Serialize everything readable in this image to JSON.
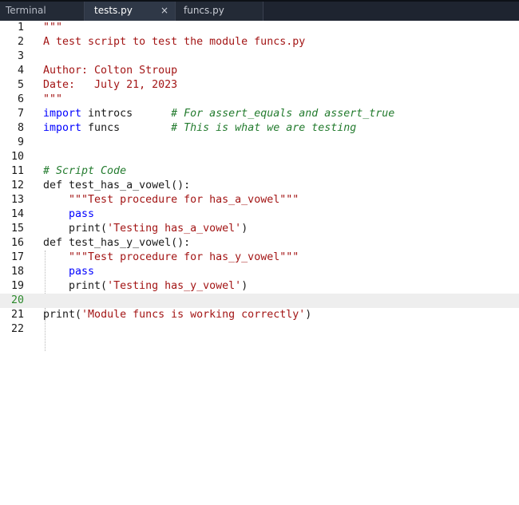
{
  "tabs": [
    {
      "label": "Terminal"
    },
    {
      "label": "tests.py",
      "close": "×"
    },
    {
      "label": "funcs.py"
    }
  ],
  "lines": [
    {
      "n": "1",
      "parts": [
        {
          "t": "\"\"\"",
          "c": "str"
        }
      ]
    },
    {
      "n": "2",
      "parts": [
        {
          "t": "A test script to test the module funcs.py",
          "c": "str"
        }
      ]
    },
    {
      "n": "3",
      "parts": []
    },
    {
      "n": "4",
      "parts": [
        {
          "t": "Author: Colton Stroup",
          "c": "str"
        }
      ]
    },
    {
      "n": "5",
      "parts": [
        {
          "t": "Date:   July 21, 2023",
          "c": "str"
        }
      ]
    },
    {
      "n": "6",
      "parts": [
        {
          "t": "\"\"\"",
          "c": "str"
        }
      ]
    },
    {
      "n": "7",
      "parts": [
        {
          "t": "import",
          "c": "kw"
        },
        {
          "t": " introcs      ",
          "c": "plain"
        },
        {
          "t": "# For assert_equals and assert_true",
          "c": "cmt"
        }
      ]
    },
    {
      "n": "8",
      "parts": [
        {
          "t": "import",
          "c": "kw"
        },
        {
          "t": " funcs        ",
          "c": "plain"
        },
        {
          "t": "# This is what we are testing",
          "c": "cmt"
        }
      ]
    },
    {
      "n": "9",
      "parts": []
    },
    {
      "n": "10",
      "parts": []
    },
    {
      "n": "11",
      "parts": [
        {
          "t": "# Script Code",
          "c": "cmt"
        }
      ]
    },
    {
      "n": "12",
      "parts": [
        {
          "t": "def test_has_a_vowel():",
          "c": "plain"
        }
      ]
    },
    {
      "n": "13",
      "parts": [
        {
          "t": "    ",
          "c": "plain"
        },
        {
          "t": "\"\"\"Test procedure for has_a_vowel\"\"\"",
          "c": "str"
        }
      ]
    },
    {
      "n": "14",
      "parts": [
        {
          "t": "    ",
          "c": "plain"
        },
        {
          "t": "pass",
          "c": "kw"
        }
      ]
    },
    {
      "n": "15",
      "parts": [
        {
          "t": "    print(",
          "c": "plain"
        },
        {
          "t": "'Testing has_a_vowel'",
          "c": "str"
        },
        {
          "t": ")",
          "c": "plain"
        }
      ]
    },
    {
      "n": "16",
      "parts": [
        {
          "t": "def test_has_y_vowel():",
          "c": "plain"
        }
      ]
    },
    {
      "n": "17",
      "parts": [
        {
          "t": "    ",
          "c": "plain"
        },
        {
          "t": "\"\"\"Test procedure for has_y_vowel\"\"\"",
          "c": "str"
        }
      ]
    },
    {
      "n": "18",
      "parts": [
        {
          "t": "    ",
          "c": "plain"
        },
        {
          "t": "pass",
          "c": "kw"
        }
      ]
    },
    {
      "n": "19",
      "parts": [
        {
          "t": "    print(",
          "c": "plain"
        },
        {
          "t": "'Testing has_y_vowel'",
          "c": "str"
        },
        {
          "t": ")",
          "c": "plain"
        }
      ]
    },
    {
      "n": "20",
      "parts": [],
      "current": true
    },
    {
      "n": "21",
      "parts": [
        {
          "t": "print(",
          "c": "plain"
        },
        {
          "t": "'Module funcs is working correctly'",
          "c": "str"
        },
        {
          "t": ")",
          "c": "plain"
        }
      ]
    },
    {
      "n": "22",
      "parts": []
    }
  ]
}
